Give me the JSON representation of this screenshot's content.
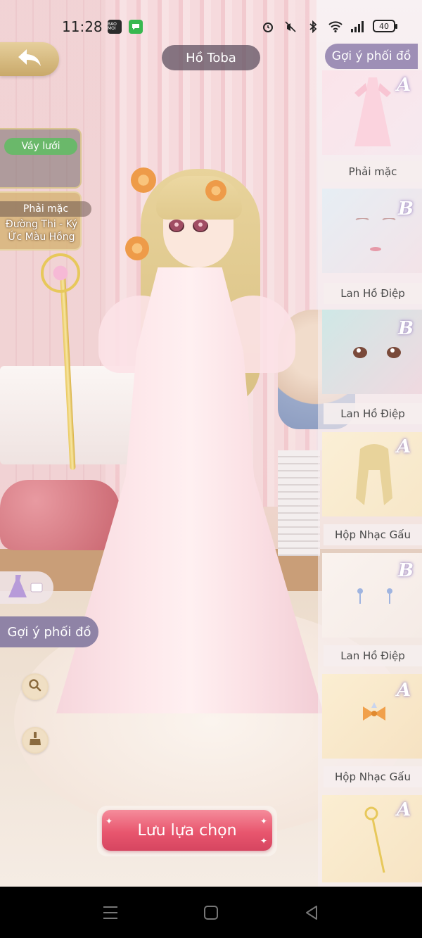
{
  "status_bar": {
    "time": "11:28",
    "app_badge_1": "BAO MOI",
    "battery": "40",
    "icons": [
      "alarm-icon",
      "mute-icon",
      "bluetooth-icon",
      "wifi-icon",
      "signal-icon"
    ]
  },
  "header": {
    "title": "Hồ Toba"
  },
  "left_panel": {
    "tag": "Váy lưới",
    "worn_label": "Phải mặc",
    "worn_item": "Đường Thi - Ký Ức Màu Hồng",
    "suggest_button": "Gợi ý phối đồ"
  },
  "right_panel": {
    "suggest_button": "Gợi ý phối đồ",
    "items": [
      {
        "grade": "A",
        "label": "Phải mặc",
        "icon": "dress-icon"
      },
      {
        "grade": "B",
        "label": "Lan Hồ Điệp",
        "icon": "makeup-icon"
      },
      {
        "grade": "B",
        "label": "Lan Hồ Điệp",
        "icon": "eyes-icon"
      },
      {
        "grade": "A",
        "label": "Hộp Nhạc Gấu",
        "icon": "hairstyle-icon"
      },
      {
        "grade": "B",
        "label": "Lan Hồ Điệp",
        "icon": "earrings-icon"
      },
      {
        "grade": "A",
        "label": "Hộp Nhạc Gấu",
        "icon": "hair-bow-icon"
      },
      {
        "grade": "A",
        "label": "",
        "icon": "wand-icon"
      }
    ]
  },
  "actions": {
    "save": "Lưu lựa chọn"
  },
  "colors": {
    "accent_pink": "#e8566e",
    "suggest_purple": "#9e8fb6",
    "tag_green": "#6ab86a",
    "gold": "#d9c48f"
  }
}
